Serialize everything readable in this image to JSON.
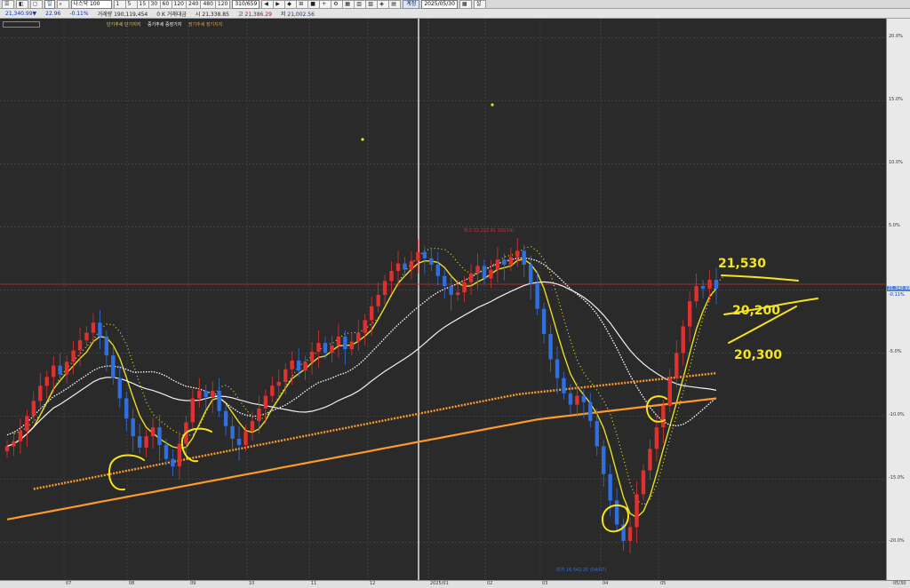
{
  "toolbar": {
    "mode_btns": [
      "☰",
      "◧",
      "◻"
    ],
    "period_value": "일",
    "symbol_name": "나스닥 100",
    "intervals": [
      "1",
      "5",
      "15",
      "30",
      "60",
      "120",
      "240",
      "480",
      "120"
    ],
    "count": "310/659",
    "nav_btns": [
      "◀",
      "▶",
      "◆",
      "⊞",
      "■",
      "+",
      "⚙",
      "▦",
      "▥",
      "▧",
      "◈",
      "▤"
    ],
    "search_label": "계정",
    "date": "2025/05/30",
    "end_btns": [
      "▦",
      "설"
    ]
  },
  "quote": {
    "price": "21,340.99▼",
    "change": "22.96",
    "change_pct": "-0.11%",
    "volume_label": "거래량",
    "volume": "190,119,454",
    "value_label": "거래대금",
    "value": "0 K",
    "open_label": "시",
    "open": "21,338.85",
    "high_label": "고",
    "high": "21,386.29",
    "low_label": "저",
    "low": "21,002.56"
  },
  "legend": [
    {
      "text": "단기추세  단기지지",
      "color": "#e8d040"
    },
    {
      "text": "중기추세  중장기지",
      "color": "#ffffff"
    },
    {
      "text": "장기추세  장기지지",
      "color": "#ff9a2a"
    }
  ],
  "price_label": "21,340.99",
  "price_label_pct": "-0.11%",
  "high_annotation": "최고 22,222.61 (02/19)",
  "low_annotation": "최저 16,542.20 (04/07)",
  "handwriting": [
    "21,530",
    "20,200",
    "20,300"
  ],
  "chart_data": {
    "type": "candlestick",
    "y_axis_unit": "%",
    "y_ticks": [
      "20.0%",
      "15.0%",
      "10.0%",
      "5.0%",
      "",
      "-5.0%",
      "-10.0%",
      "-15.0%",
      "-20.0%"
    ],
    "y_tick_values": [
      20,
      15,
      10,
      5,
      0,
      -5,
      -10,
      -15,
      -20
    ],
    "ylim": [
      -23,
      21.5
    ],
    "x_ticks": [
      "07",
      "08",
      "09",
      "10",
      "11",
      "12",
      "2025/01",
      "02",
      "03",
      "04",
      "05",
      "05/30"
    ],
    "colors": {
      "up": "#e03030",
      "down": "#2f6fe0"
    },
    "closes": [
      -12.4,
      -12.0,
      -11.2,
      -10.0,
      -8.8,
      -7.6,
      -6.9,
      -6.0,
      -6.7,
      -5.7,
      -4.8,
      -4.0,
      -3.4,
      -2.6,
      -3.7,
      -5.2,
      -7.0,
      -8.6,
      -10.2,
      -11.6,
      -12.5,
      -11.6,
      -10.9,
      -12.3,
      -13.4,
      -14.0,
      -12.2,
      -10.5,
      -8.6,
      -8.0,
      -8.5,
      -8.0,
      -9.6,
      -10.8,
      -11.8,
      -12.3,
      -11.2,
      -10.4,
      -9.4,
      -8.4,
      -7.6,
      -7.3,
      -6.3,
      -5.6,
      -6.4,
      -5.7,
      -4.9,
      -4.2,
      -5.0,
      -4.4,
      -3.7,
      -4.7,
      -4.1,
      -3.4,
      -2.4,
      -1.3,
      -0.4,
      0.7,
      1.5,
      2.1,
      1.6,
      2.3,
      3.0,
      2.5,
      2.0,
      1.1,
      0.3,
      -0.4,
      -0.2,
      0.6,
      1.3,
      1.9,
      0.9,
      1.6,
      2.4,
      2.0,
      2.6,
      3.1,
      2.0,
      0.5,
      -1.5,
      -3.5,
      -5.5,
      -7.0,
      -8.2,
      -9.1,
      -8.4,
      -8.9,
      -10.4,
      -12.4,
      -14.6,
      -16.7,
      -18.6,
      -19.9,
      -18.8,
      -16.2,
      -14.3,
      -12.6,
      -10.9,
      -9.2,
      -7.0,
      -5.0,
      -2.9,
      -0.9,
      0.3,
      0.1,
      0.8,
      0.1
    ]
  }
}
